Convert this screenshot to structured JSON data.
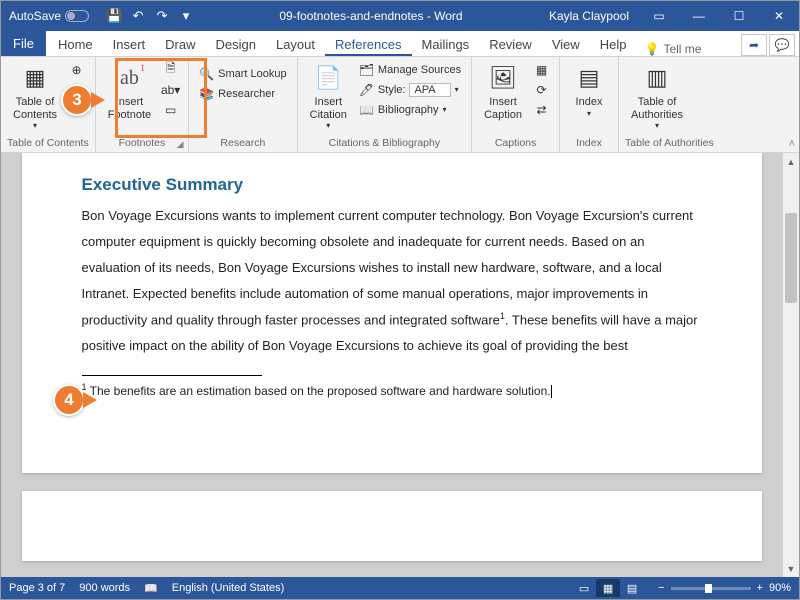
{
  "titlebar": {
    "autosave_label": "AutoSave",
    "autosave_state": "Off",
    "title": "09-footnotes-and-endnotes - Word",
    "user": "Kayla Claypool"
  },
  "tabs": {
    "file": "File",
    "items": [
      "Home",
      "Insert",
      "Draw",
      "Design",
      "Layout",
      "References",
      "Mailings",
      "Review",
      "View",
      "Help"
    ],
    "active_index": 5,
    "tell_me": "Tell me"
  },
  "ribbon": {
    "groups": {
      "toc": {
        "label": "Table of Contents",
        "btn": "Table of\nContents"
      },
      "footnotes": {
        "label": "Footnotes",
        "btn": "Insert\nFootnote"
      },
      "research": {
        "label": "Research",
        "smart": "Smart Lookup",
        "researcher": "Researcher"
      },
      "citations": {
        "label": "Citations & Bibliography",
        "btn": "Insert\nCitation",
        "manage": "Manage Sources",
        "style_label": "Style:",
        "style_value": "APA",
        "biblio": "Bibliography"
      },
      "captions": {
        "label": "Captions",
        "btn": "Insert\nCaption"
      },
      "index": {
        "label": "Index",
        "btn": "Index"
      },
      "authorities": {
        "label": "Table of Authorities",
        "btn": "Table of\nAuthorities"
      }
    }
  },
  "callouts": {
    "c3": "3",
    "c4": "4"
  },
  "document": {
    "heading": "Executive Summary",
    "body": "Bon Voyage Excursions wants to implement current computer technology. Bon Voyage Excursion's current computer equipment is quickly becoming obsolete and inadequate for current needs. Based on an evaluation of its needs, Bon Voyage Excursions wishes to install new hardware, software, and a local Intranet. Expected benefits include automation of some manual operations, major improvements in productivity and quality through faster processes and integrated software",
    "body2": ". These benefits will have a major positive impact on the ability of Bon Voyage Excursions to achieve its goal of providing the best",
    "footnote_ref": "1",
    "footnote_num": "1",
    "footnote_text": " The benefits are an estimation based on the proposed software and hardware solution."
  },
  "statusbar": {
    "page": "Page 3 of 7",
    "words": "900 words",
    "lang": "English (United States)",
    "zoom": "90%"
  }
}
